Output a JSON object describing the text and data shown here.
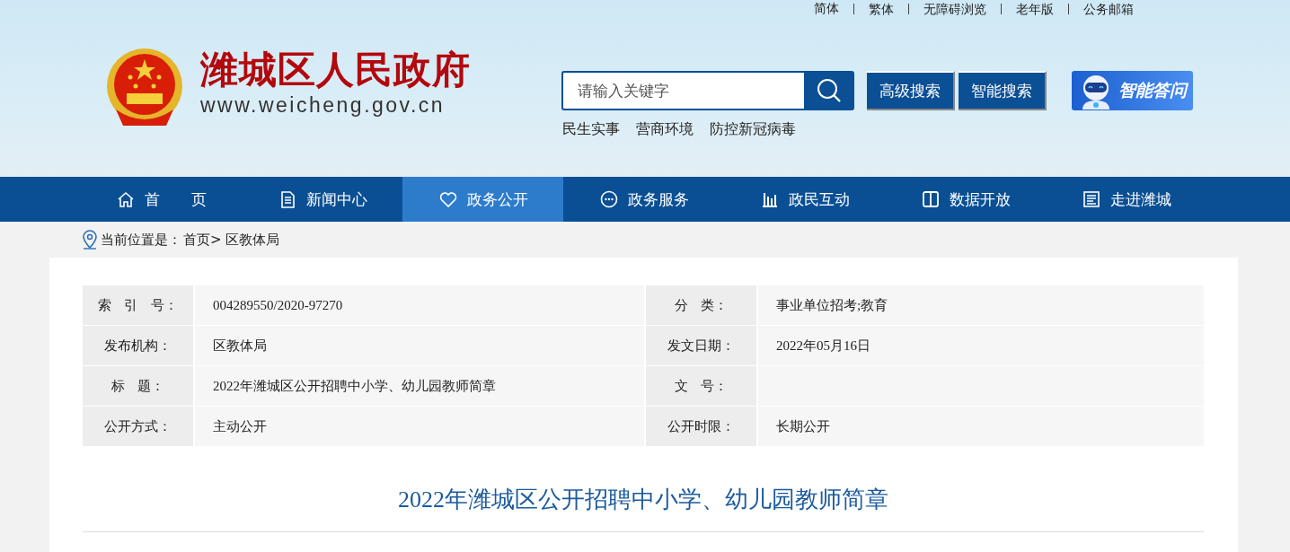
{
  "top_links": [
    "简体",
    "繁体",
    "无障碍浏览",
    "老年版",
    "公务邮箱"
  ],
  "site": {
    "title": "潍城区人民政府",
    "url": "www.weicheng.gov.cn"
  },
  "search": {
    "placeholder": "请输入关键字",
    "buttons": [
      "高级搜索",
      "智能搜索"
    ],
    "assistant": "智能答问"
  },
  "hot_links": [
    "民生实事",
    "营商环境",
    "防控新冠病毒"
  ],
  "nav": [
    {
      "label": "首 页",
      "selected": false
    },
    {
      "label": "新闻中心",
      "selected": false
    },
    {
      "label": "政务公开",
      "selected": true
    },
    {
      "label": "政务服务",
      "selected": false
    },
    {
      "label": "政民互动",
      "selected": false
    },
    {
      "label": "数据开放",
      "selected": false
    },
    {
      "label": "走进潍城",
      "selected": false
    }
  ],
  "breadcrumb": {
    "label": "当前位置是：",
    "path": "首页> 区教体局"
  },
  "info": [
    [
      {
        "label": "索 引 号：",
        "value": "004289550/2020-97270"
      },
      {
        "label": "分 类：",
        "value": "事业单位招考;教育"
      }
    ],
    [
      {
        "label": "发布机构：",
        "value": "区教体局"
      },
      {
        "label": "发文日期：",
        "value": "2022年05月16日"
      }
    ],
    [
      {
        "label": "标 题：",
        "value": "2022年潍城区公开招聘中小学、幼儿园教师简章"
      },
      {
        "label": "文 号："
      }
    ],
    [
      {
        "label": "公开方式：",
        "value": "主动公开"
      },
      {
        "label": "公开时限：",
        "value": "长期公开"
      }
    ]
  ],
  "article_title": "2022年潍城区公开招聘中小学、幼儿园教师简章"
}
